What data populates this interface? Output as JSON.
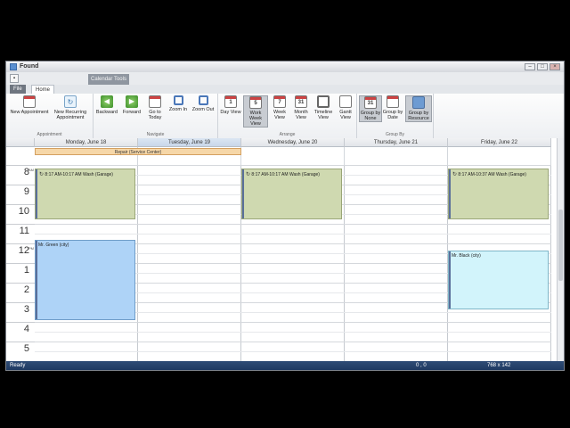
{
  "window": {
    "title": "Found"
  },
  "ribbon": {
    "file_tab": "File",
    "home_tab": "Home",
    "context_tab": "Calendar Tools",
    "groups": {
      "appointment": {
        "label": "Appointment",
        "new_appointment": "New Appointment",
        "new_recurring": "New Recurring Appointment"
      },
      "navigate": {
        "label": "Navigate",
        "backward": "Backward",
        "forward": "Forward",
        "go_to_today": "Go to Today",
        "zoom_in": "Zoom In",
        "zoom_out": "Zoom Out"
      },
      "arrange": {
        "label": "Arrange",
        "day_view": "Day View",
        "work_week_view": "Work Week View",
        "week_view": "Week View",
        "month_view": "Month View",
        "timeline_view": "Timeline View",
        "gantt_view": "Gantt View",
        "icon_numbers": {
          "day": "1",
          "work_week": "5",
          "week": "7",
          "month": "31"
        }
      },
      "group_by": {
        "label": "Group By",
        "none": "Group by None",
        "date": "Group by Date",
        "resource": "Group by Resource",
        "none_icon": "31"
      }
    }
  },
  "calendar": {
    "days": [
      "Monday, June 18",
      "Tuesday, June 19",
      "Wednesday, June 20",
      "Thursday, June 21",
      "Friday, June 22"
    ],
    "allday_appointment": "Repair (Service Center)",
    "hours": [
      {
        "h": "8",
        "ap": "AM"
      },
      {
        "h": "9",
        "ap": ""
      },
      {
        "h": "10",
        "ap": ""
      },
      {
        "h": "11",
        "ap": ""
      },
      {
        "h": "12",
        "ap": "PM"
      },
      {
        "h": "1",
        "ap": ""
      },
      {
        "h": "2",
        "ap": ""
      },
      {
        "h": "3",
        "ap": ""
      },
      {
        "h": "4",
        "ap": ""
      },
      {
        "h": "5",
        "ap": ""
      }
    ],
    "appointments": {
      "mon_wash": "8:17 AM-10:17 AM Wash (Garage)",
      "wed_wash": "8:17 AM-10:17 AM Wash (Garage)",
      "fri_wash": "8:17 AM-10:37 AM Wash (Garage)",
      "mon_green": "Mr. Green (city)",
      "fri_black": "Mr. Black (city)"
    }
  },
  "status": {
    "left": "Ready",
    "mid": "0 , 0",
    "right": "768 x 142"
  },
  "icons": [
    "app-icon",
    "recurrence-icon",
    "backward-icon",
    "forward-icon",
    "zoom-in-icon",
    "zoom-out-icon",
    "clock-icon",
    "gantt-icon",
    "people-icon"
  ]
}
